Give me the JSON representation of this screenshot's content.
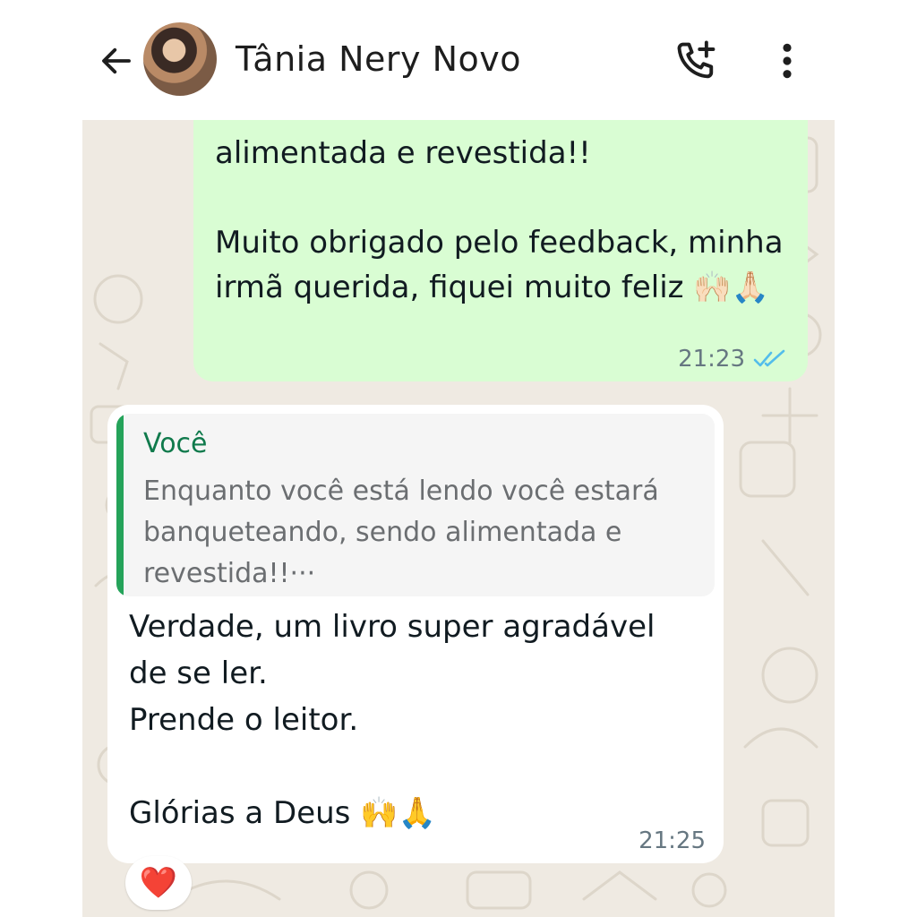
{
  "header": {
    "contact_name": "Tânia Nery Novo",
    "back_icon": "arrow-left-icon",
    "call_icon": "add-call-icon",
    "menu_icon": "more-vertical-icon"
  },
  "messages": [
    {
      "direction": "outgoing",
      "text": "alimentada e revestida!!\n\nMuito obrigado pelo feedback, minha irmã querida, fiquei muito feliz 🙌🏻🙏🏻",
      "time": "21:23",
      "status": "read",
      "status_color": "#53bdeb"
    },
    {
      "direction": "incoming",
      "quote": {
        "author": "Você",
        "text": "Enquanto você está lendo você estará banqueteando, sendo alimentada e revestida!!···"
      },
      "text": "Verdade, um livro super agradável de se ler.\nPrende o leitor.\n\nGlórias a Deus 🙌🙏",
      "time": "21:25",
      "reaction": "❤️"
    }
  ],
  "colors": {
    "outgoing_bubble": "#d9fdd3",
    "incoming_bubble": "#ffffff",
    "chat_background": "#efeae2",
    "quote_accent": "#25a35a",
    "quote_author": "#107a4c"
  }
}
